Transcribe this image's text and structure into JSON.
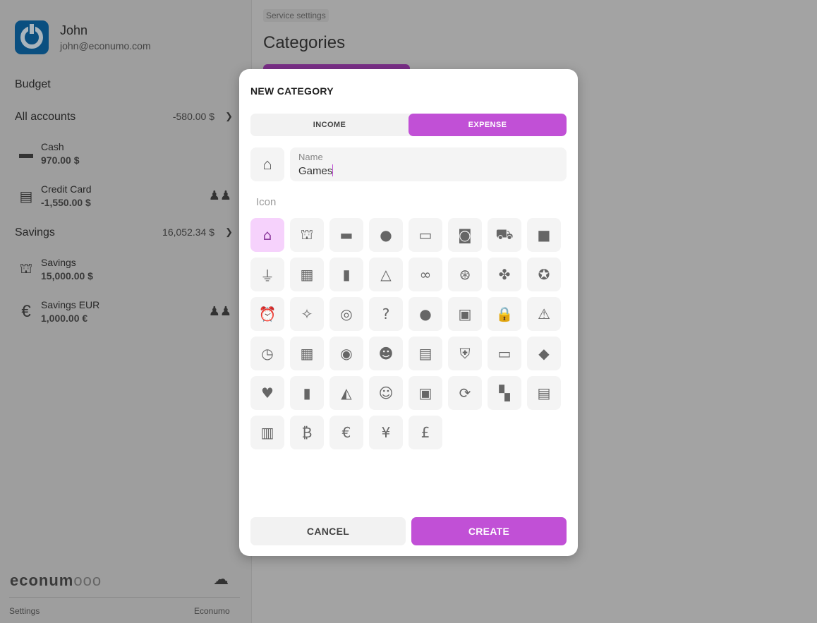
{
  "user": {
    "name": "John",
    "email": "john@econumo.com"
  },
  "sidebar": {
    "budget_label": "Budget",
    "groups": [
      {
        "label": "All accounts",
        "total": "-580.00 $",
        "accounts": [
          {
            "name": "Cash",
            "balance": "970.00 $",
            "icon": "wallet-icon",
            "shared": false
          },
          {
            "name": "Credit Card",
            "balance": "-1,550.00 $",
            "icon": "credit-card-icon",
            "shared": true
          }
        ]
      },
      {
        "label": "Savings",
        "total": "16,052.34 $",
        "accounts": [
          {
            "name": "Savings",
            "balance": "15,000.00 $",
            "icon": "bank-icon",
            "shared": false
          },
          {
            "name": "Savings EUR",
            "balance": "1,000.00 €",
            "icon": "euro-icon",
            "shared": true
          }
        ]
      }
    ],
    "logo": "econum",
    "footer": {
      "settings": "Settings",
      "app": "Econumo"
    }
  },
  "main": {
    "breadcrumb": "Service settings",
    "title": "Categories"
  },
  "dialog": {
    "title": "NEW CATEGORY",
    "types": [
      {
        "label": "INCOME",
        "active": false
      },
      {
        "label": "EXPENSE",
        "active": true
      }
    ],
    "name_label": "Name",
    "name_value": "Games",
    "icon_label": "Icon",
    "selected_icon": "home",
    "accent": "#c150d6",
    "icons": [
      "home",
      "account_balance",
      "wallet",
      "savings",
      "credit_card",
      "account_balance_wallet",
      "shopping_cart",
      "shopping_bag",
      "shopping_basket",
      "store",
      "bar_chart",
      "change_history",
      "all_inclusive",
      "support",
      "extension",
      "stars",
      "alarm",
      "celebration",
      "fingerprint",
      "question_mark",
      "lightbulb",
      "event",
      "lock",
      "warning",
      "schedule",
      "calendar_month",
      "visibility",
      "account_circle",
      "badge",
      "health_and_safety",
      "credit_score",
      "loyalty",
      "favorite",
      "delete",
      "assistant_navigation",
      "face",
      "payments",
      "currency_exchange",
      "qr_code",
      "receipt",
      "redeem",
      "currency_bitcoin",
      "euro",
      "currency_yen",
      "currency_pound"
    ],
    "cancel": "CANCEL",
    "create": "CREATE"
  }
}
